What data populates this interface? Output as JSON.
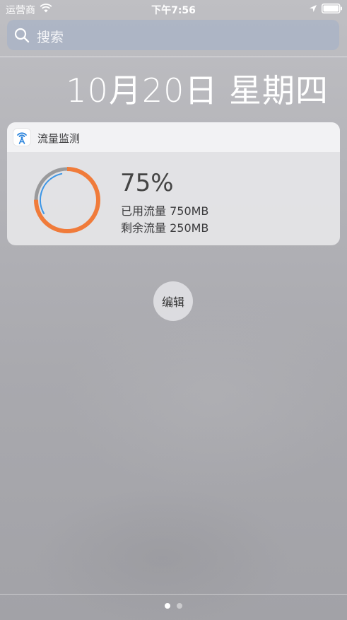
{
  "status_bar": {
    "carrier": "运营商",
    "time": "下午7:56"
  },
  "search": {
    "placeholder": "搜索"
  },
  "date": "10月20日 星期四",
  "widget": {
    "title": "流量监测",
    "percent": "75%",
    "used_label": "已用流量 750MB",
    "remaining_label": "剩余流量 250MB",
    "used_fraction": 0.75,
    "inner_fraction": 0.3,
    "colors": {
      "used_ring": "#f07b3a",
      "track_ring": "#9a9a9c",
      "inner_arc": "#3a95e6"
    }
  },
  "edit_button": {
    "label": "编辑"
  },
  "page_indicator": {
    "count": 2,
    "active": 1
  }
}
